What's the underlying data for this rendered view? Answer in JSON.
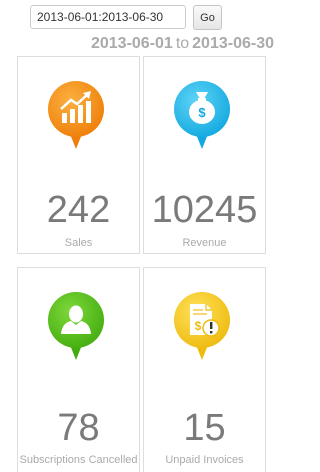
{
  "filter": {
    "date_value": "2013-06-01:2013-06-30",
    "go_label": "Go"
  },
  "range": {
    "start": "2013-06-01",
    "to": "to",
    "end": "2013-06-30"
  },
  "cards": [
    {
      "value": "242",
      "label": "Sales",
      "color": "#f08a0b",
      "icon": "bar-chart-icon"
    },
    {
      "value": "10245",
      "label": "Revenue",
      "color": "#1bb6e8",
      "icon": "money-bag-icon"
    },
    {
      "value": "78",
      "label": "Subscriptions Cancelled",
      "color": "#4cb816",
      "icon": "user-icon"
    },
    {
      "value": "15",
      "label": "Unpaid Invoices",
      "color": "#f0c419",
      "icon": "invoice-alert-icon"
    }
  ]
}
